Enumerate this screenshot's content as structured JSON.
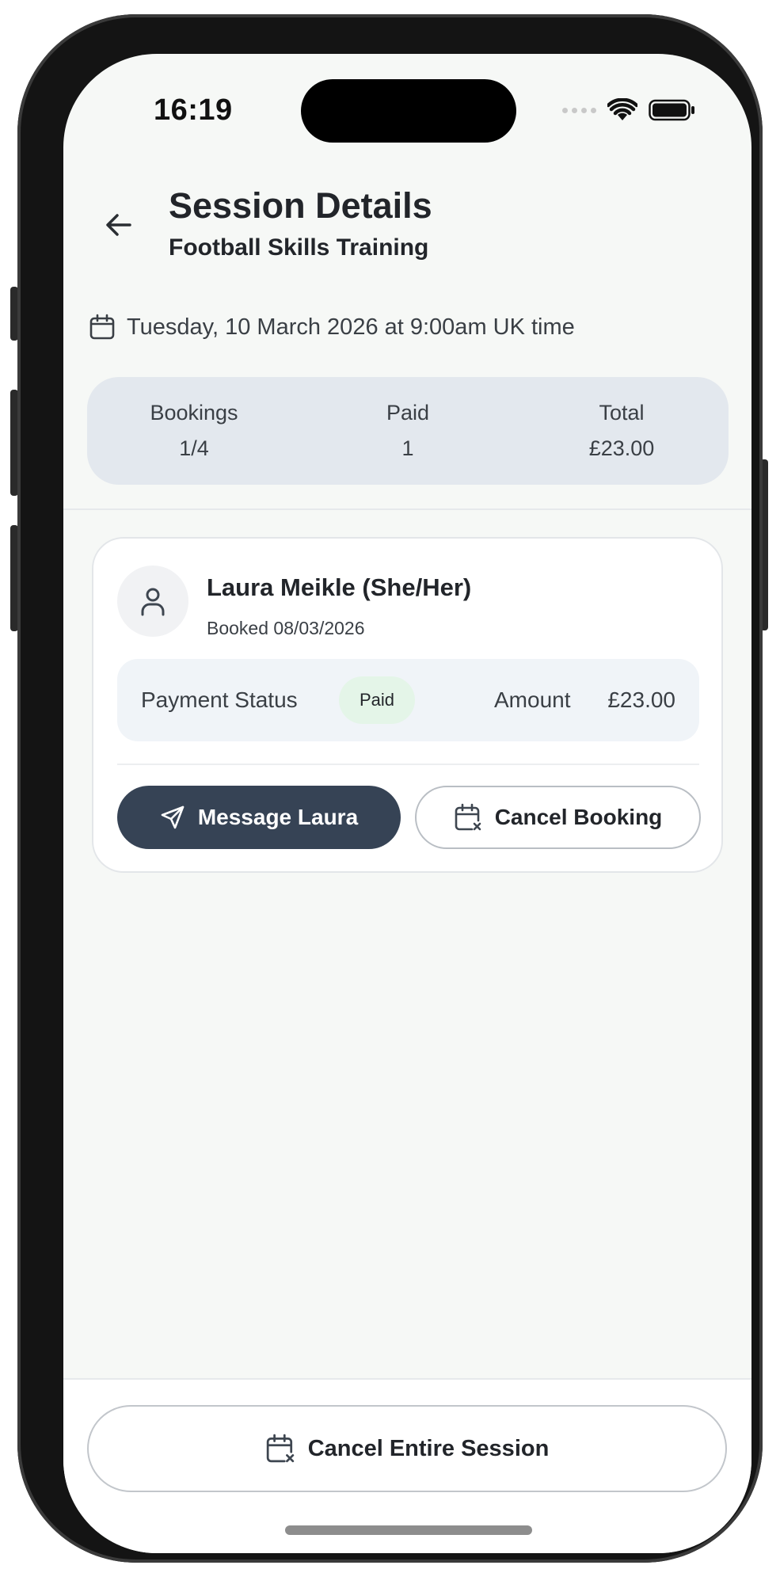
{
  "status_bar": {
    "time": "16:19"
  },
  "header": {
    "title": "Session Details",
    "subtitle": "Football Skills Training"
  },
  "session": {
    "date_text": "Tuesday, 10 March 2026 at 9:00am UK time"
  },
  "summary": {
    "bookings_label": "Bookings",
    "bookings_value": "1/4",
    "paid_label": "Paid",
    "paid_value": "1",
    "total_label": "Total",
    "total_value": "£23.00"
  },
  "booking": {
    "name": "Laura Meikle (She/Her)",
    "booked_text": "Booked 08/03/2026",
    "payment_status_label": "Payment Status",
    "payment_status_badge": "Paid",
    "amount_label": "Amount",
    "amount_value": "£23.00",
    "message_button": "Message Laura",
    "cancel_button": "Cancel Booking"
  },
  "footer": {
    "cancel_session_button": "Cancel Entire Session"
  },
  "icons": {
    "back": "arrow-left-icon",
    "calendar": "calendar-icon",
    "user": "user-icon",
    "send": "send-icon",
    "calendar_cancel": "calendar-x-icon",
    "wifi": "wifi-icon",
    "battery": "battery-icon"
  },
  "colors": {
    "background": "#f6f8f6",
    "summary_bg": "#e3e8ee",
    "primary_button": "#364355",
    "paid_badge_bg": "#e4f5e8",
    "payment_panel_bg": "#f0f4f8"
  }
}
